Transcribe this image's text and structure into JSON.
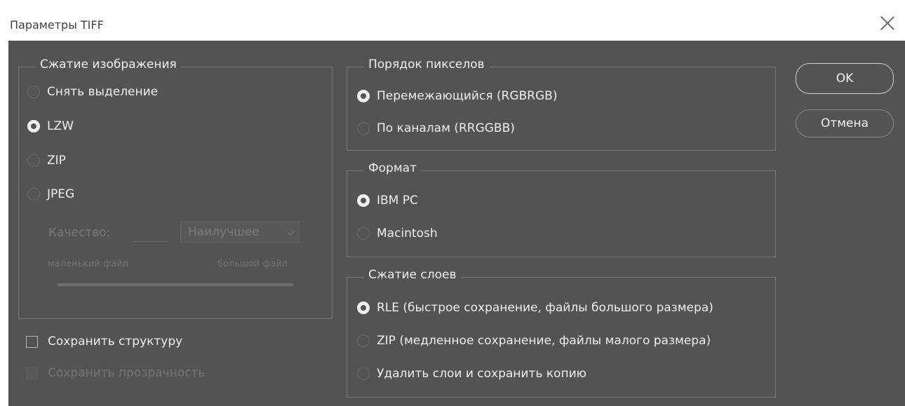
{
  "window": {
    "title": "Параметры TIFF"
  },
  "image_compression": {
    "legend": "Сжатие изображения",
    "options": [
      {
        "label": "Снять выделение",
        "selected": false
      },
      {
        "label": "LZW",
        "selected": true
      },
      {
        "label": "ZIP",
        "selected": false
      },
      {
        "label": "JPEG",
        "selected": false
      }
    ],
    "quality_label": "Качество:",
    "quality_value": "",
    "quality_select": "Наилучшее",
    "small_file": "маленький файл",
    "large_file": "большой файл"
  },
  "save_structure": {
    "label": "Сохранить структуру",
    "checked": false
  },
  "save_transparency": {
    "label": "Сохранить прозрачность",
    "checked": false,
    "disabled": true
  },
  "pixel_order": {
    "legend": "Порядок пикселов",
    "options": [
      {
        "label": "Перемежающийся (RGBRGB)",
        "selected": true
      },
      {
        "label": "По каналам (RRGGBB)",
        "selected": false
      }
    ]
  },
  "byte_order": {
    "legend": "Формат",
    "options": [
      {
        "label": "IBM PC",
        "selected": true
      },
      {
        "label": "Macintosh",
        "selected": false
      }
    ]
  },
  "layer_compression": {
    "legend": "Сжатие слоев",
    "options": [
      {
        "label": "RLE (быстрое сохранение, файлы большого размера)",
        "selected": true
      },
      {
        "label": "ZIP (медленное сохранение, файлы малого размера)",
        "selected": false
      },
      {
        "label": "Удалить слои и сохранить копию",
        "selected": false
      }
    ]
  },
  "buttons": {
    "ok": "OK",
    "cancel": "Отмена"
  }
}
